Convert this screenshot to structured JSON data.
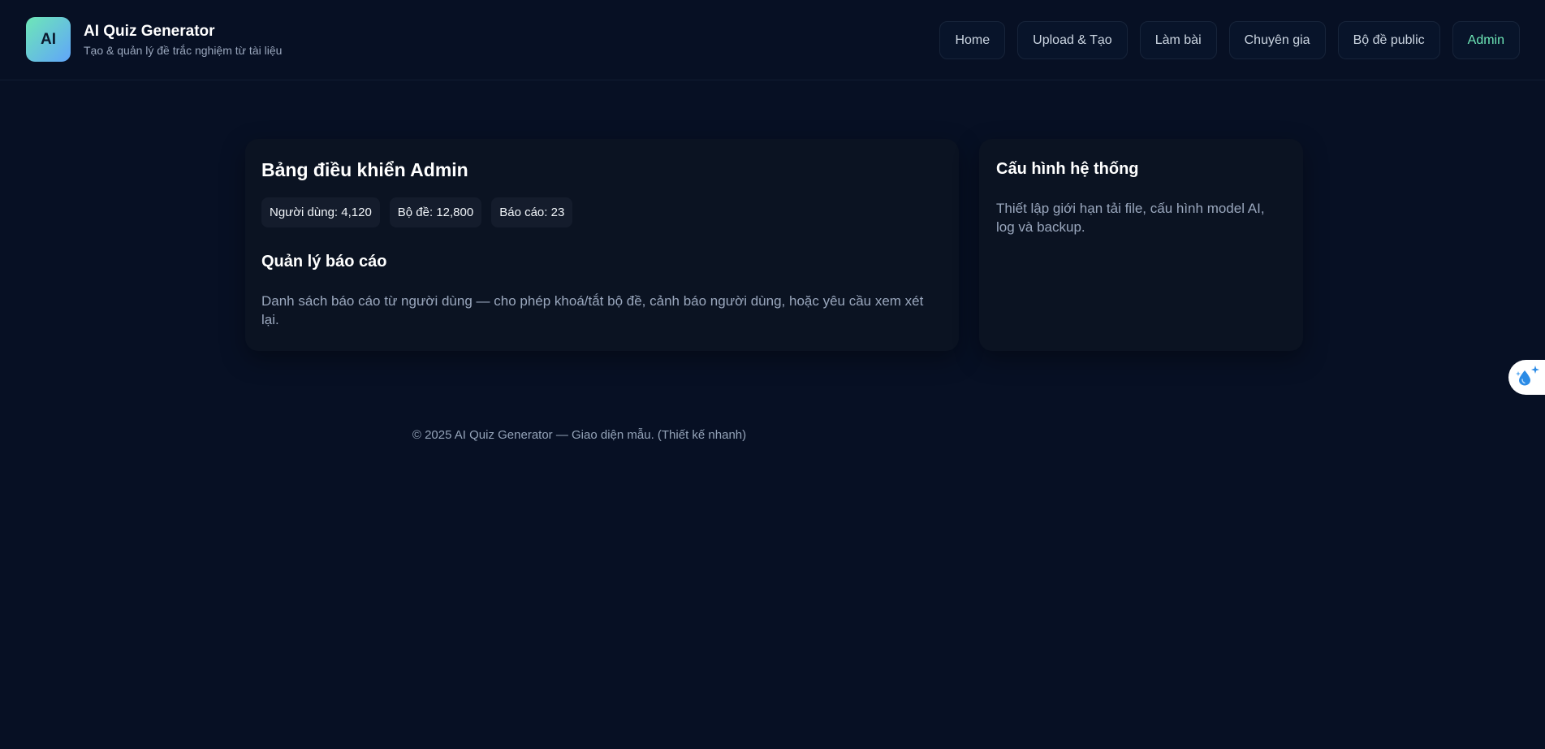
{
  "brand": {
    "logo_text": "AI",
    "title": "AI Quiz Generator",
    "subtitle": "Tạo & quản lý đề trắc nghiệm từ tài liệu"
  },
  "nav": {
    "items": [
      {
        "label": "Home",
        "active": false
      },
      {
        "label": "Upload & Tạo",
        "active": false
      },
      {
        "label": "Làm bài",
        "active": false
      },
      {
        "label": "Chuyên gia",
        "active": false
      },
      {
        "label": "Bộ đề public",
        "active": false
      },
      {
        "label": "Admin",
        "active": true
      }
    ]
  },
  "admin": {
    "title": "Bảng điều khiển Admin",
    "stats": [
      {
        "label": "Người dùng: 4,120"
      },
      {
        "label": "Bộ đề: 12,800"
      },
      {
        "label": "Báo cáo: 23"
      }
    ],
    "reports_title": "Quản lý báo cáo",
    "reports_desc": "Danh sách báo cáo từ người dùng — cho phép khoá/tắt bộ đề, cảnh báo người dùng, hoặc yêu cầu xem xét lại."
  },
  "config": {
    "title": "Cấu hình hệ thống",
    "desc": "Thiết lập giới hạn tải file, cấu hình model AI, log và backup."
  },
  "footer": {
    "text": "© 2025 AI Quiz Generator — Giao diện mẫu. (Thiết kế nhanh)"
  },
  "floating": {
    "icon": "droplet-sparkle-icon"
  },
  "colors": {
    "background": "#071024",
    "accent": "#6ee7b7",
    "card": "#0b1322"
  }
}
